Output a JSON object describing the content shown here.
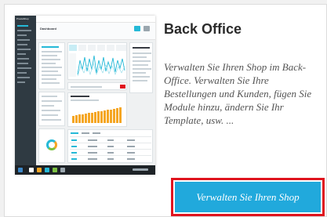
{
  "card": {
    "title": "Back Office",
    "description": "Verwalten Sie Ihren Shop im Back-Office. Verwalten Sie Ihre Bestellungen und Kunden, fügen Sie Module hinzu, ändern Sie Ihr Template, usw. ...",
    "button_label": "Verwalten Sie Ihren Shop"
  },
  "thumbnail": {
    "logo_text": "PrestaShop",
    "page_heading": "Dashboard",
    "line_chart_color": "#25b9d7",
    "bar_chart_color": "#f5a623"
  },
  "colors": {
    "button": "#21a9dc",
    "button_border": "#e0141e",
    "sidebar": "#2f3a42"
  }
}
